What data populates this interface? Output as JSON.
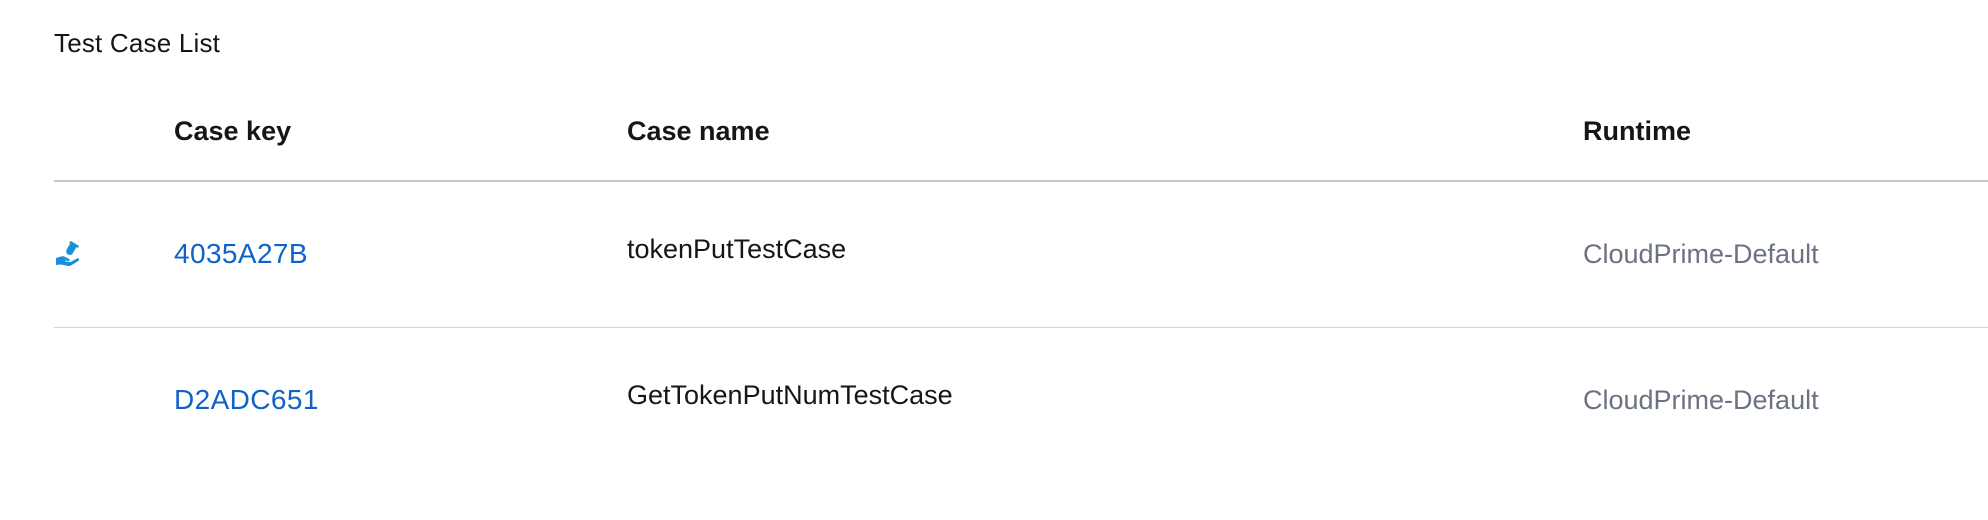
{
  "section": {
    "title": "Test Case List"
  },
  "table": {
    "headers": {
      "key": "Case key",
      "name": "Case name",
      "runtime": "Runtime"
    },
    "rows": [
      {
        "key": "4035A27B",
        "name": "tokenPutTestCase",
        "runtime": "CloudPrime-Default",
        "icon": "run-test-icon"
      },
      {
        "key": "D2ADC651",
        "name": "GetTokenPutNumTestCase",
        "runtime": "CloudPrime-Default",
        "icon": ""
      }
    ]
  },
  "colors": {
    "link": "#0f62c8",
    "icon": "#1a8fd8",
    "muted_text": "#6b7280",
    "divider": "#c8c8c8"
  }
}
